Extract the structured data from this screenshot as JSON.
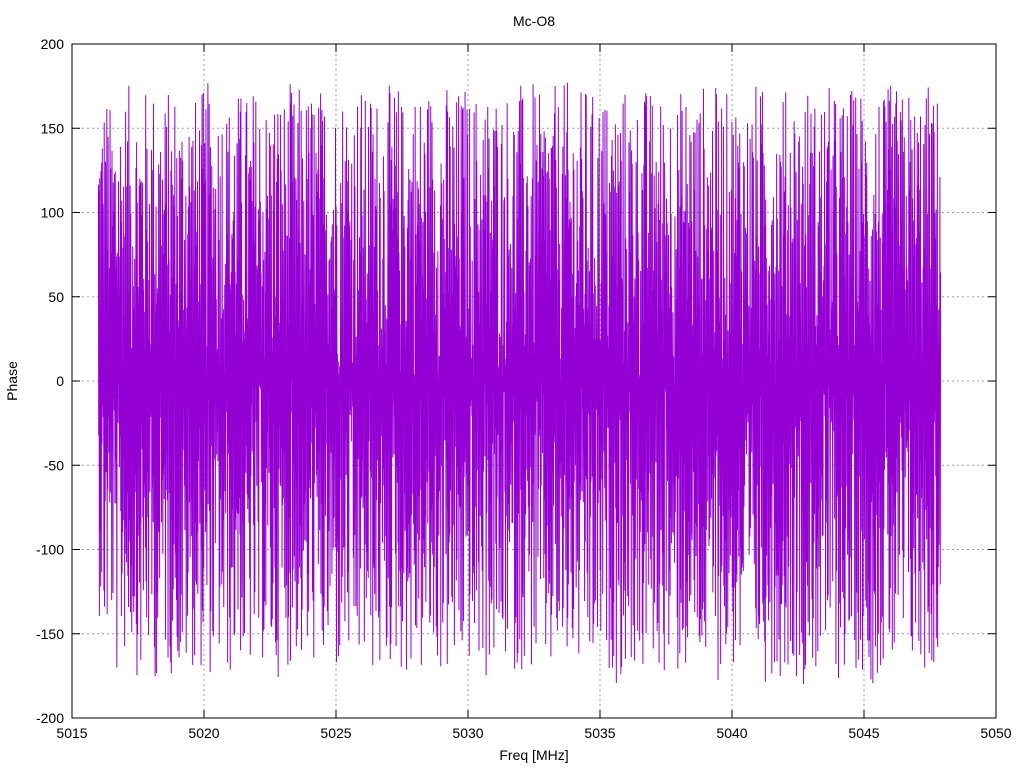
{
  "chart_data": {
    "type": "line",
    "title": "Mc-O8",
    "xlabel": "Freq [MHz]",
    "ylabel": "Phase",
    "xlim": [
      5015,
      5050
    ],
    "ylim": [
      -200,
      200
    ],
    "xticks": [
      5015,
      5020,
      5025,
      5030,
      5035,
      5040,
      5045,
      5050
    ],
    "yticks": [
      -200,
      -150,
      -100,
      -50,
      0,
      50,
      100,
      150,
      200
    ],
    "xtick_labels": [
      "5015",
      "5020",
      "5025",
      "5030",
      "5035",
      "5040",
      "5045",
      "5050"
    ],
    "ytick_labels": [
      "-200",
      "-150",
      "-100",
      "-50",
      "0",
      "50",
      "100",
      "150",
      "200"
    ],
    "grid": true,
    "legend": "none",
    "series": [
      {
        "color": "#9400d3",
        "x_range": [
          5016.0,
          5047.9
        ],
        "y_range": [
          -180,
          180
        ],
        "description_values": {
          "x": [
            5016.0,
            5016.2,
            5016.4,
            5016.6,
            5016.8,
            5017.0,
            5017.2,
            5017.4,
            5017.6,
            5017.8,
            5018.0,
            5018.2,
            5018.4,
            5018.6,
            5018.8,
            5019.0,
            5019.2,
            5019.4,
            5019.6,
            5019.8,
            5020.0,
            5020.2,
            5020.4,
            5020.6,
            5020.8,
            5021.0,
            5021.2,
            5021.4,
            5021.6,
            5021.8,
            5022.0,
            5022.2,
            5022.4,
            5022.6,
            5022.8,
            5023.0,
            5023.2,
            5023.4,
            5023.6,
            5023.8,
            5024.0,
            5024.2,
            5024.4,
            5024.6,
            5024.8,
            5025.0,
            5025.2,
            5025.4,
            5025.6,
            5025.8,
            5026.0,
            5026.2,
            5026.4,
            5026.6,
            5026.8,
            5027.0,
            5027.2,
            5027.4,
            5027.6,
            5027.8,
            5028.0,
            5028.2,
            5028.4,
            5028.6,
            5028.8,
            5029.0,
            5029.2,
            5029.4,
            5029.6,
            5029.8,
            5030.0,
            5030.2,
            5030.4,
            5030.6,
            5030.8,
            5031.0,
            5031.2,
            5031.4,
            5031.6,
            5031.8,
            5032.0,
            5032.2,
            5032.4,
            5032.6,
            5032.8,
            5033.0,
            5033.2,
            5033.4,
            5033.6,
            5033.8,
            5034.0,
            5034.2,
            5034.4,
            5034.6,
            5034.8,
            5035.0,
            5035.2,
            5035.4,
            5035.6,
            5035.8,
            5036.0,
            5036.2,
            5036.4,
            5036.6,
            5036.8,
            5037.0,
            5037.2,
            5037.4,
            5037.6,
            5037.8,
            5038.0,
            5038.2,
            5038.4,
            5038.6,
            5038.8,
            5039.0,
            5039.2,
            5039.4,
            5039.6,
            5039.8,
            5040.0,
            5040.2,
            5040.4,
            5040.6,
            5040.8,
            5041.0,
            5041.2,
            5041.4,
            5041.6,
            5041.8,
            5042.0,
            5042.2,
            5042.4,
            5042.6,
            5042.8,
            5043.0,
            5043.2,
            5043.4,
            5043.6,
            5043.8,
            5044.0,
            5044.2,
            5044.4,
            5044.6,
            5044.8,
            5045.0,
            5045.2,
            5045.4,
            5045.6,
            5045.8,
            5046.0,
            5046.2,
            5046.4,
            5046.6,
            5046.8,
            5047.0,
            5047.2,
            5047.4,
            5047.6,
            5047.8
          ],
          "y_min": [
            -140,
            -160,
            -150,
            -180,
            -165,
            -170,
            -160,
            -175,
            -180,
            -170,
            -178,
            -172,
            -165,
            -175,
            -160,
            -180,
            -178,
            -170,
            -175,
            -172,
            -180,
            -176,
            -170,
            -174,
            -178,
            -172,
            -166,
            -180,
            -175,
            -170,
            -178,
            -168,
            -174,
            -180,
            -176,
            -170,
            -172,
            -165,
            -174,
            -178,
            -170,
            -180,
            -176,
            -172,
            -168,
            -178,
            -170,
            -174,
            -180,
            -175,
            -172,
            -176,
            -170,
            -180,
            -178,
            -172,
            -168,
            -175,
            -176,
            -180,
            -172,
            -178,
            -170,
            -174,
            -176,
            -168,
            -178,
            -180,
            -172,
            -176,
            -170,
            -178,
            -174,
            -180,
            -172,
            -176,
            -178,
            -170,
            -174,
            -180,
            -172,
            -178,
            -175,
            -170,
            -176,
            -180,
            -172,
            -178,
            -174,
            -170,
            -176,
            -180,
            -172,
            -178,
            -174,
            -170,
            -176,
            -172,
            -180,
            -178,
            -170,
            -174,
            -176,
            -180,
            -172,
            -168,
            -178,
            -174,
            -176,
            -180,
            -172,
            -178,
            -170,
            -176,
            -174,
            -180,
            -172,
            -178,
            -176,
            -170,
            -174,
            -180,
            -178,
            -172,
            -176,
            -170,
            -180,
            -174,
            -178,
            -176,
            -172,
            -170,
            -178,
            -180,
            -174,
            -176,
            -172,
            -178,
            -170,
            -176,
            -180,
            -174,
            -178,
            -172,
            -176,
            -170,
            -180,
            -178,
            -174,
            -176,
            -180,
            -172,
            -178,
            -170,
            -176,
            -180,
            -174,
            -178,
            -172,
            -176
          ],
          "y_max": [
            170,
            175,
            165,
            178,
            172,
            176,
            170,
            178,
            175,
            172,
            178,
            176,
            170,
            174,
            178,
            172,
            176,
            178,
            170,
            174,
            178,
            176,
            172,
            178,
            170,
            176,
            174,
            178,
            172,
            176,
            178,
            170,
            174,
            178,
            176,
            172,
            178,
            170,
            176,
            174,
            178,
            172,
            176,
            178,
            170,
            174,
            178,
            176,
            172,
            178,
            170,
            176,
            174,
            178,
            172,
            176,
            178,
            170,
            174,
            178,
            176,
            172,
            178,
            170,
            176,
            174,
            178,
            172,
            176,
            178,
            170,
            174,
            178,
            176,
            172,
            178,
            170,
            176,
            174,
            178,
            172,
            176,
            178,
            170,
            174,
            178,
            176,
            172,
            178,
            170,
            176,
            174,
            178,
            172,
            176,
            178,
            170,
            174,
            178,
            176,
            172,
            178,
            170,
            176,
            174,
            178,
            172,
            176,
            178,
            170,
            174,
            178,
            176,
            172,
            178,
            170,
            176,
            174,
            178,
            172,
            176,
            178,
            170,
            174,
            178,
            176,
            172,
            178,
            170,
            176,
            174,
            178,
            172,
            176,
            178,
            170,
            174,
            178,
            176,
            172,
            178,
            170,
            176,
            174,
            178,
            172,
            176,
            178,
            170,
            174,
            178,
            176,
            172,
            178,
            170,
            176,
            174,
            178,
            172,
            176
          ]
        }
      }
    ]
  }
}
